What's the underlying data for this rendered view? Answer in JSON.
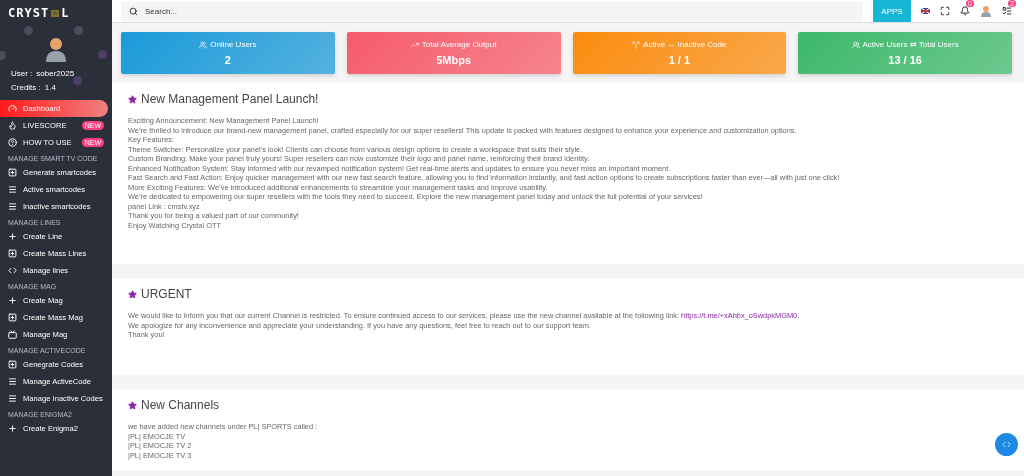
{
  "logo": {
    "before": "CRYST",
    "after": "L"
  },
  "user": {
    "label": "User :",
    "name": "sober2025",
    "credits_label": "Credits :",
    "credits": "1.4"
  },
  "sidebar": [
    {
      "kind": "item",
      "label": "Dashboard",
      "selected": true
    },
    {
      "kind": "item",
      "label": "LIVESCORE",
      "badge": "NEW",
      "selected": false
    },
    {
      "kind": "item",
      "label": "HOW TO USE",
      "badge": "NEW",
      "selected": false
    },
    {
      "kind": "heading",
      "label": "MANAGE SMART TV CODE"
    },
    {
      "kind": "item",
      "label": "Generate smartcodes",
      "selected": false
    },
    {
      "kind": "item",
      "label": "Active smartcodes",
      "selected": false
    },
    {
      "kind": "item",
      "label": "Inactive smartcodes",
      "selected": false
    },
    {
      "kind": "heading",
      "label": "MANAGE LINES"
    },
    {
      "kind": "item",
      "label": "Create Line",
      "selected": false
    },
    {
      "kind": "item",
      "label": "Create Mass Lines",
      "selected": false
    },
    {
      "kind": "item",
      "label": "Manage lines",
      "selected": false
    },
    {
      "kind": "heading",
      "label": "MANAGE MAG"
    },
    {
      "kind": "item",
      "label": "Create Mag",
      "selected": false
    },
    {
      "kind": "item",
      "label": "Create Mass Mag",
      "selected": false
    },
    {
      "kind": "item",
      "label": "Manage Mag",
      "selected": false
    },
    {
      "kind": "heading",
      "label": "MANAGE ACTIVECODE"
    },
    {
      "kind": "item",
      "label": "Genegrate Codes",
      "selected": false
    },
    {
      "kind": "item",
      "label": "Manage ActiveCode",
      "selected": false
    },
    {
      "kind": "item",
      "label": "Manage Inactive Codes",
      "selected": false
    },
    {
      "kind": "heading",
      "label": "MANAGE ENIGMA2"
    },
    {
      "kind": "item",
      "label": "Create Enigma2",
      "selected": false
    }
  ],
  "topbar": {
    "search": {
      "placeholder": "Search..."
    },
    "apps": "APPS",
    "notifications": "0",
    "tasks": "2"
  },
  "stats": [
    {
      "title": "Online Users",
      "value": "2",
      "color": "#1a9ad8"
    },
    {
      "title": "Total Average Output",
      "value": "5Mbps",
      "color": "#f65b6a"
    },
    {
      "title": "Active ↔ Inactive Code",
      "value": "1 / 1",
      "color": "#fb8c0e"
    },
    {
      "title": "Active Users ⇄ Total Users",
      "value": "13 / 16",
      "color": "#3cb86a"
    }
  ],
  "posts": [
    {
      "title": "New Management Panel Launch!",
      "lines": [
        {
          "text": "Exciting Announcement: New Management Panel Launch!"
        },
        {
          "text": "We’re thrilled to introduce our brand-new management panel, crafted especially for our super resellers! This update is packed with features designed to enhance your experience and customization options."
        },
        {
          "text": "Key Features:"
        },
        {
          "text": "Theme Switcher: Personalize your panel’s look! Clients can choose from various design options to create a workspace that suits their style."
        },
        {
          "text": "Custom Branding: Make your panel truly yours! Super resellers can now customize their logo and panel name, reinforcing their brand identity."
        },
        {
          "text": "Enhanced Notification System: Stay informed with our revamped notification system! Get real-time alerts and updates to ensure you never miss an important moment."
        },
        {
          "text": "Fast Search and Fast Action: Enjoy quicker management with our new fast search feature, allowing you to find information instantly, and fast action options to create subscriptions faster than ever—all with just one click!"
        },
        {
          "text": "More Exciting Features: We’ve introduced additional enhancements to streamline your management tasks and improve usability."
        },
        {
          "text": "We’re dedicated to empowering our super resellers with the tools they need to succeed. Explore the new management panel today and unlock the full potential of your services!"
        },
        {
          "text": "panel Link : cmstv.xyz"
        },
        {
          "text": "Thank you for being a valued part of our community!"
        },
        {
          "text": "Enjoy Watching Crystal OTT"
        }
      ]
    },
    {
      "title": "URGENT",
      "lines": [
        {
          "text": "We would like to inform you that our current Channel is restricted. To ensure continued access to our services, please use the new channel available at the following link:",
          "link": "https://t.me/+xAhbx_oSwdpkMGM0."
        },
        {
          "text": "We apologize for any inconvenience and appreciate your understanding. If you have any questions, feel free to reach out to our support team."
        },
        {
          "text": "Thank you!"
        }
      ]
    },
    {
      "title": "New Channels",
      "lines": [
        {
          "text": "we have added new channels under PL| SPORTS called :"
        },
        {
          "text": "|PL| EMOCJE TV"
        },
        {
          "text": "|PL| EMOCJE TV 2"
        },
        {
          "text": "|PL| EMOCJE TV 3"
        }
      ]
    }
  ]
}
